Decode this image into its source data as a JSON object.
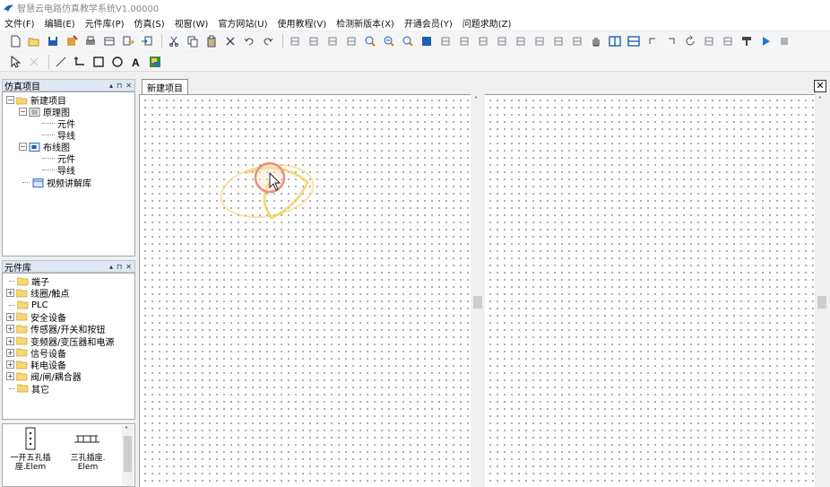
{
  "window": {
    "title": "智慧云电路仿真教学系统V1.00000"
  },
  "menu": [
    {
      "label": "文件(F)"
    },
    {
      "label": "编辑(E)"
    },
    {
      "label": "元件库(P)"
    },
    {
      "label": "仿真(S)"
    },
    {
      "label": "视窗(W)"
    },
    {
      "label": "官方网站(U)"
    },
    {
      "label": "使用教程(V)"
    },
    {
      "label": "检测新版本(X)"
    },
    {
      "label": "开通会员(Y)"
    },
    {
      "label": "问题求助(Z)"
    }
  ],
  "panels": {
    "simulation": {
      "title": "仿真项目",
      "tree": {
        "root": "新建项目",
        "schematic": "原理图",
        "schematic_children": [
          "元件",
          "导线"
        ],
        "wiring": "布线图",
        "wiring_children": [
          "元件",
          "导线"
        ],
        "video": "视频讲解库"
      }
    },
    "library": {
      "title": "元件库",
      "items": [
        {
          "label": "端子",
          "expandable": false
        },
        {
          "label": "线圈/触点",
          "expandable": true
        },
        {
          "label": "PLC",
          "expandable": false
        },
        {
          "label": "安全设备",
          "expandable": true
        },
        {
          "label": "传感器/开关和按钮",
          "expandable": true
        },
        {
          "label": "变频器/变压器和电源",
          "expandable": true
        },
        {
          "label": "信号设备",
          "expandable": true
        },
        {
          "label": "耗电设备",
          "expandable": true
        },
        {
          "label": "阀/闸/耦合器",
          "expandable": true
        },
        {
          "label": "其它",
          "expandable": false
        }
      ]
    },
    "preview": {
      "items": [
        {
          "line1": "一开五孔插",
          "line2": "座.Elem"
        },
        {
          "line1": "三孔插座.",
          "line2": "Elem"
        }
      ]
    }
  },
  "document": {
    "tab_label": "新建项目",
    "close_glyph": "✕"
  },
  "panel_controls": {
    "pin": "▴",
    "float": "⊓",
    "close": "✕"
  },
  "icons": {
    "toolbar1": [
      "new-file-icon",
      "open-folder-icon",
      "save-icon",
      "save-as-icon",
      "print-icon",
      "print-preview-icon",
      "export-icon",
      "import-icon",
      "cut-icon",
      "copy-icon",
      "paste-icon",
      "delete-icon",
      "undo-icon",
      "redo-icon",
      "align-left-icon",
      "align-top-icon",
      "align-right-icon",
      "align-bottom-icon",
      "zoom-in-icon",
      "zoom-out-icon",
      "zoom-fit-icon",
      "select-all-icon",
      "distribute-h-icon",
      "distribute-v-icon",
      "space-h-icon",
      "space-v-icon",
      "bring-front-icon",
      "send-back-icon",
      "bring-forward-icon",
      "send-backward-icon",
      "pan-hand-icon",
      "tile-v-icon",
      "tile-h-icon",
      "rotate-left-icon",
      "rotate-right-icon",
      "refresh-icon",
      "group-icon",
      "ungroup-icon",
      "format-painter-icon",
      "run-icon",
      "stop-icon"
    ],
    "toolbar2": [
      "pointer-icon",
      "disabled-select-icon",
      "line-tool-icon",
      "wire-tool-icon",
      "rectangle-tool-icon",
      "ellipse-tool-icon",
      "text-tool-icon",
      "image-tool-icon"
    ]
  },
  "colors": {
    "folder": "#f2c94c",
    "accent_blue": "#1f5fae",
    "highlight": "#f0c35a",
    "run": "#1f7ad6"
  }
}
